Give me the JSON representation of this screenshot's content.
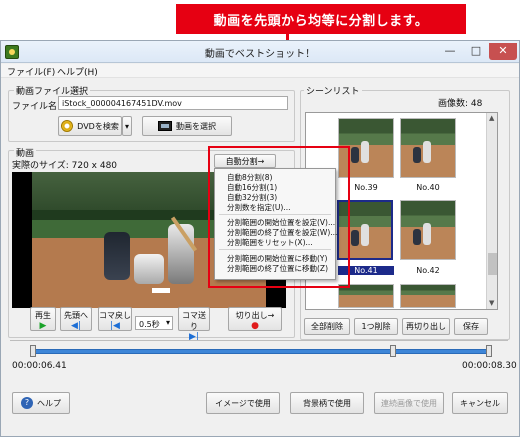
{
  "annotation": {
    "text": "動画を先頭から均等に分割します。",
    "color": "#e60012"
  },
  "window": {
    "title": "動画でベストショット！",
    "min": "—",
    "max": "□",
    "close": "✕"
  },
  "menu": [
    "ファイル(F)",
    "ヘルプ(H)"
  ],
  "file_group": {
    "label": "動画ファイル選択",
    "file_name_label": "ファイル名",
    "file_name_value": "iStock_000004167451DV.mov",
    "dvd_button": "DVDを検索",
    "dvd_arrow": "▾",
    "select_button": "動画を選択"
  },
  "video_group": {
    "label": "動画",
    "size_text": "実際のサイズ: 720 x 480",
    "auto_split_button": "自動分割→"
  },
  "context_menu": {
    "items": [
      "自動8分割(8)",
      "自動16分割(1)",
      "自動32分割(3)",
      "分割数を指定(U)...",
      "分割範囲の開始位置を設定(V)...",
      "分割範囲の終了位置を設定(W)...",
      "分割範囲をリセット(X)...",
      "分割範囲の開始位置に移動(Y)",
      "分割範囲の終了位置に移動(Z)"
    ]
  },
  "controls": {
    "play": {
      "label": "再生",
      "glyph": "▶"
    },
    "to_start": {
      "label": "先頭へ",
      "glyph": "◀|"
    },
    "step_back": {
      "label": "コマ戻し",
      "glyph": "|◀"
    },
    "step_value": "0.5秒",
    "step_forward": {
      "label": "コマ送り",
      "glyph": "▶|"
    },
    "cut": {
      "label": "切り出し→",
      "glyph": "●"
    }
  },
  "scene_list": {
    "label": "シーンリスト",
    "count_text": "画像数: 48",
    "thumbnails": [
      {
        "label": "No.39"
      },
      {
        "label": "No.40"
      },
      {
        "label": "No.41"
      },
      {
        "label": "No.42"
      },
      {
        "label": ""
      },
      {
        "label": ""
      }
    ],
    "selected_index": 2,
    "buttons": {
      "delete_all": "全部削除",
      "delete_one": "1つ削除",
      "recut": "再切り出し",
      "save": "保存"
    }
  },
  "timeline": {
    "start_time": "00:00:06.41",
    "end_time": "00:00:08.30",
    "left_time": "00:00:00.00",
    "right_time": "00:00:08.30"
  },
  "bottom_buttons": {
    "help": "ヘルプ",
    "use_image": "イメージで使用",
    "use_bg": "背景柄で使用",
    "use_continuous": "連続画像で使用",
    "cancel": "キャンセル"
  }
}
